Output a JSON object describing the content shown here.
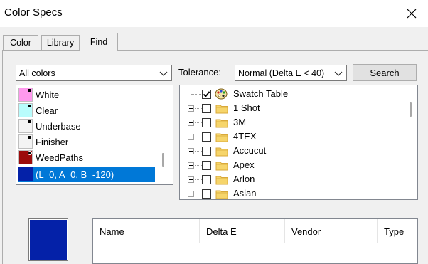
{
  "window": {
    "title": "Color Specs"
  },
  "tabs": [
    {
      "label": "Color"
    },
    {
      "label": "Library"
    },
    {
      "label": "Find"
    }
  ],
  "filter": {
    "selected": "All colors"
  },
  "tolerance": {
    "label": "Tolerance:",
    "selected": "Normal (Delta E < 40)"
  },
  "search_label": "Search",
  "colors_list": [
    {
      "name": "White",
      "swatch": "#ff99ee",
      "marker": "dot"
    },
    {
      "name": "Clear",
      "swatch": "#b8fcfc",
      "marker": "dot"
    },
    {
      "name": "Underbase",
      "swatch": "#f4f4f4",
      "marker": "dot"
    },
    {
      "name": "Finisher",
      "swatch": "#f4f4f4",
      "marker": "dot"
    },
    {
      "name": "WeedPaths",
      "swatch": "#9c0b0b",
      "marker": "ring"
    },
    {
      "name": "(L=0, A=0, B=-120)",
      "swatch": "#0421a8",
      "marker": "none",
      "selected": true
    }
  ],
  "tree": [
    {
      "label": "Swatch Table",
      "checked": true,
      "icon": "palette-icon",
      "expandable": false
    },
    {
      "label": "1 Shot",
      "checked": false,
      "icon": "folder-icon",
      "expandable": true
    },
    {
      "label": "3M",
      "checked": false,
      "icon": "folder-icon",
      "expandable": true
    },
    {
      "label": "4TEX",
      "checked": false,
      "icon": "folder-icon",
      "expandable": true
    },
    {
      "label": "Accucut",
      "checked": false,
      "icon": "folder-icon",
      "expandable": true
    },
    {
      "label": "Apex",
      "checked": false,
      "icon": "folder-icon",
      "expandable": true
    },
    {
      "label": "Arlon",
      "checked": false,
      "icon": "folder-icon",
      "expandable": true
    },
    {
      "label": "Aslan",
      "checked": false,
      "icon": "folder-icon",
      "expandable": true
    }
  ],
  "preview": {
    "color": "#0421a8"
  },
  "results_columns": [
    {
      "label": "Name"
    },
    {
      "label": "Delta E"
    },
    {
      "label": "Vendor"
    },
    {
      "label": "Type"
    }
  ],
  "colors": {
    "selection": "#0078d7",
    "folder": "#f6d56b",
    "folder_dark": "#d9a93a"
  }
}
